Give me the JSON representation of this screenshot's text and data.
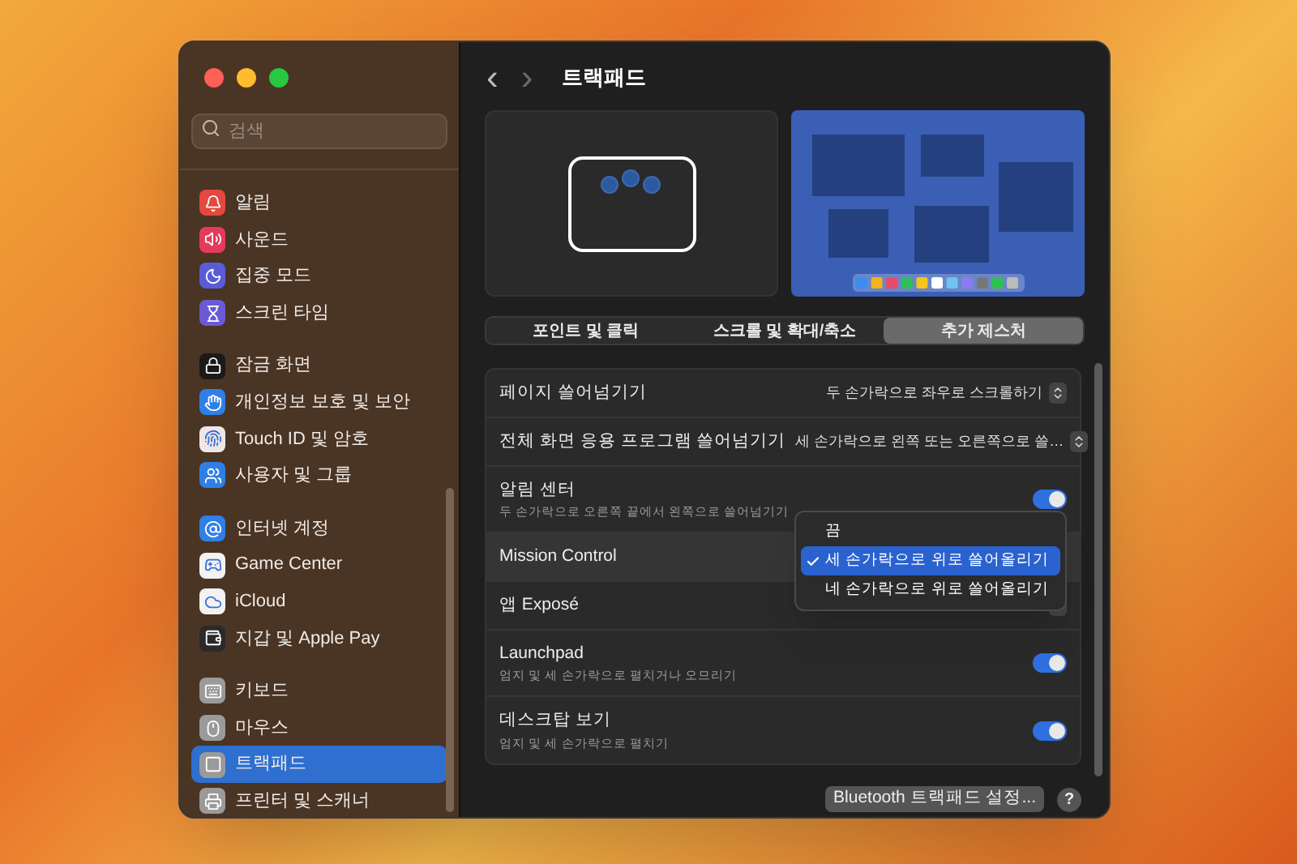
{
  "sidebar": {
    "search": {
      "placeholder": "검색"
    },
    "groups": [
      [
        {
          "label": "알림",
          "color": "#e5483f",
          "selected": false
        },
        {
          "label": "사운드",
          "color": "#e53a5c",
          "selected": false
        },
        {
          "label": "집중 모드",
          "color": "#5b5bd6",
          "selected": false
        },
        {
          "label": "스크린 타임",
          "color": "#6a5ad6",
          "selected": false
        }
      ],
      [
        {
          "label": "잠금 화면",
          "color": "#1a1a1a",
          "selected": false
        },
        {
          "label": "개인정보 보호 및 보안",
          "color": "#2f7fe6",
          "selected": false
        },
        {
          "label": "Touch ID 및 암호",
          "color": "#f0e6e6",
          "selected": false
        },
        {
          "label": "사용자 및 그룹",
          "color": "#2f7fe6",
          "selected": false
        }
      ],
      [
        {
          "label": "인터넷 계정",
          "color": "#2f7fe6",
          "selected": false
        },
        {
          "label": "Game Center",
          "color": "#f2f2f2",
          "selected": false
        },
        {
          "label": "iCloud",
          "color": "#f2f2f2",
          "selected": false
        },
        {
          "label": "지갑 및 Apple Pay",
          "color": "#2a2a2a",
          "selected": false
        }
      ],
      [
        {
          "label": "키보드",
          "color": "#9a9a9a",
          "selected": false
        },
        {
          "label": "마우스",
          "color": "#9a9a9a",
          "selected": false
        },
        {
          "label": "트랙패드",
          "color": "#9a9a9a",
          "selected": true
        },
        {
          "label": "프린터 및 스캐너",
          "color": "#9a9a9a",
          "selected": false
        }
      ]
    ]
  },
  "header": {
    "back": "‹",
    "forward": "›",
    "title": "트랙패드"
  },
  "tabs": [
    {
      "label": "포인트 및 클릭",
      "selected": false
    },
    {
      "label": "스크롤 및 확대/축소",
      "selected": false
    },
    {
      "label": "추가 제스처",
      "selected": true
    }
  ],
  "settings": [
    {
      "kind": "select",
      "label": "페이지 쓸어넘기기",
      "value": "두 손가락으로 좌우로 스크롤하기"
    },
    {
      "kind": "select",
      "label": "전체 화면 응용 프로그램 쓸어넘기기",
      "value": "세 손가락으로 왼쪽 또는 오른쪽으로 쓸…"
    },
    {
      "kind": "toggle",
      "label": "알림 센터",
      "description": "두 손가락으로 오른쪽 끝에서 왼쪽으로 쓸어넘기기",
      "on": true
    },
    {
      "kind": "select",
      "label": "Mission Control",
      "highlighted": true,
      "menu": [
        {
          "label": "끔",
          "selected": false
        },
        {
          "label": "세 손가락으로 위로 쓸어올리기",
          "selected": true
        },
        {
          "label": "네 손가락으로 위로 쓸어올리기",
          "selected": false
        }
      ]
    },
    {
      "kind": "select",
      "label": "앱 Exposé"
    },
    {
      "kind": "toggle",
      "label": "Launchpad",
      "description": "엄지 및 세 손가락으로 펼치거나 오므리기",
      "on": true
    },
    {
      "kind": "toggle",
      "label": "데스크탑 보기",
      "description": "엄지 및 세 손가락으로 펼치기",
      "on": true
    }
  ],
  "footer": {
    "button": "Bluetooth 트랙패드 설정...",
    "help": "?"
  }
}
